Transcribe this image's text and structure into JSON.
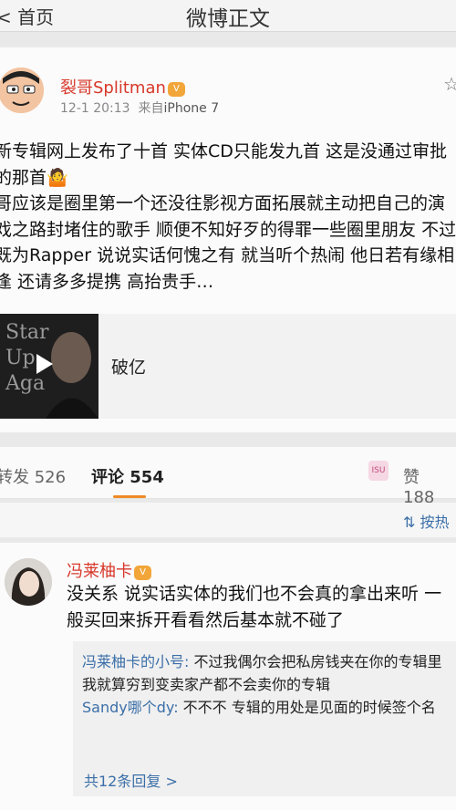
{
  "header": {
    "back_label": "首页",
    "title": "微博正文"
  },
  "post": {
    "user_name": "裂哥Splitman",
    "date": "12-1 20:13",
    "source_prefix": "来自",
    "source": "iPhone 7",
    "text_p1": "新专辑网上发布了十首 实体CD只能发九首 这是没通过审批的那首🤷",
    "text_p2": "哥应该是圈里第一个还没往影视方面拓展就主动把自己的演戏之路封堵住的歌手 顺便不知好歹的得罪一些圈里朋友 不过既为Rapper 说说实话何愧之有 就当听个热闹 他日若有缘相逢 还请多多提携 高抬贵手…",
    "media": {
      "title": "破亿",
      "cover_text": [
        "Star",
        "Up",
        "Aga"
      ]
    }
  },
  "tabs": {
    "repost_label": "转发",
    "repost_count": "526",
    "comment_label": "评论",
    "comment_count": "554",
    "like_label": "赞",
    "like_count": "188"
  },
  "sort_label": "按热",
  "comment": {
    "user_name": "冯莱柚卡",
    "text": "没关系 说实话实体的我们也不会真的拿出来听 一般买回来拆开看看然后基本就不碰了",
    "replies": [
      {
        "name": "冯莱柚卡的小号:",
        "text": " 不过我偶尔会把私房钱夹在你的专辑里 我就算穷到变卖家产都不会卖你的专辑"
      },
      {
        "name": "Sandy哪个dy:",
        "text": " 不不不 专辑的用处是见面的时候签个名"
      }
    ],
    "more_label": "共12条回复 >"
  },
  "colors": {
    "accent_orange": "#f08a24",
    "name_red": "#d7382a",
    "link_blue": "#3b6fa8"
  }
}
